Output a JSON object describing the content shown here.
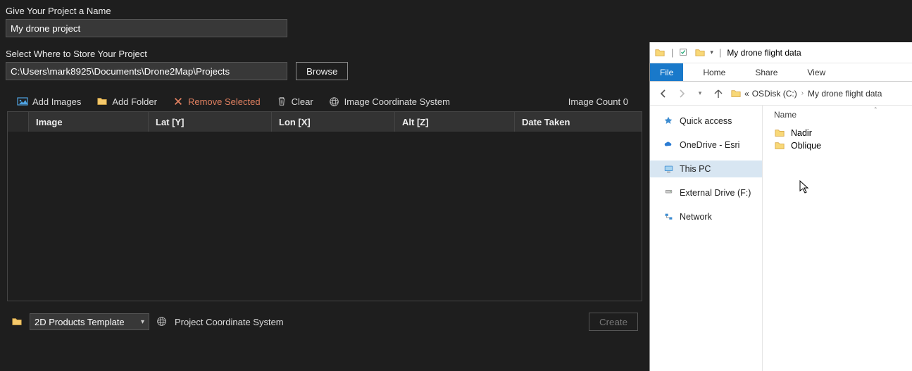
{
  "project": {
    "name_label": "Give Your Project a Name",
    "name_value": "My drone project",
    "store_label": "Select Where to Store Your Project",
    "store_value": "C:\\Users\\mark8925\\Documents\\Drone2Map\\Projects",
    "browse_label": "Browse"
  },
  "toolbar": {
    "add_images": "Add Images",
    "add_folder": "Add Folder",
    "remove_selected": "Remove Selected",
    "clear": "Clear",
    "image_cs": "Image Coordinate System",
    "image_count_label": "Image Count",
    "image_count_value": "0"
  },
  "table": {
    "headers": {
      "image": "Image",
      "lat": "Lat [Y]",
      "lon": "Lon [X]",
      "alt": "Alt [Z]",
      "date": "Date Taken"
    }
  },
  "footer": {
    "template_selected": "2D Products Template",
    "proj_cs": "Project Coordinate System",
    "create": "Create"
  },
  "explorer": {
    "window_title": "My drone flight data",
    "ribbon": {
      "file": "File",
      "home": "Home",
      "share": "Share",
      "view": "View"
    },
    "breadcrumb": {
      "prefix": "«",
      "drive": "OSDisk (C:)",
      "folder": "My drone flight data"
    },
    "sidebar": {
      "quick_access": "Quick access",
      "onedrive": "OneDrive - Esri",
      "this_pc": "This PC",
      "external": "External Drive (F:)",
      "network": "Network"
    },
    "column_name": "Name",
    "items": [
      {
        "name": "Nadir"
      },
      {
        "name": "Oblique"
      }
    ]
  }
}
